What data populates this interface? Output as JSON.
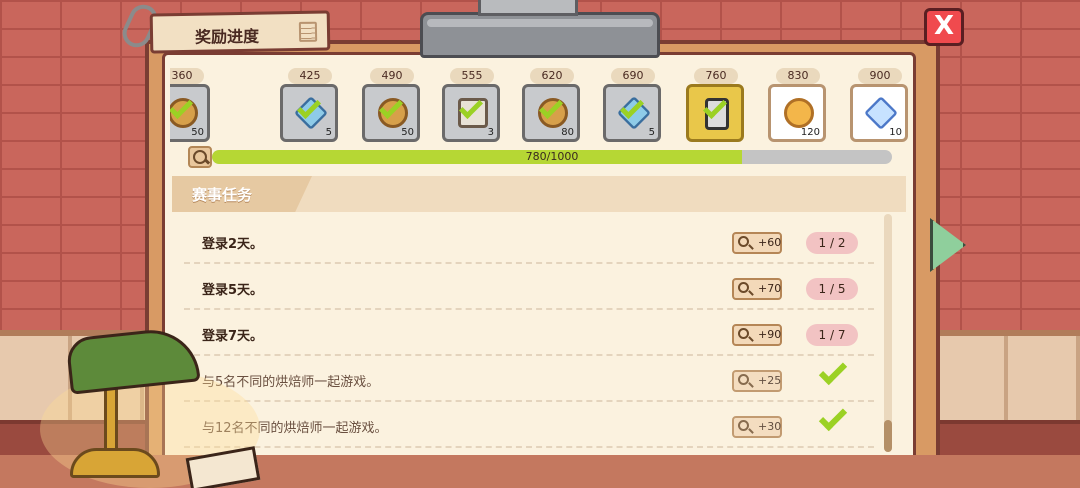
{
  "window": {
    "title": "奖励进度",
    "close_label": "X"
  },
  "rewards": [
    {
      "threshold": "360",
      "count": "50",
      "icon": "coin-icon",
      "state": "claimed"
    },
    {
      "threshold": "425",
      "count": "5",
      "icon": "gem-icon",
      "state": "claimed"
    },
    {
      "threshold": "490",
      "count": "50",
      "icon": "coin-icon",
      "state": "claimed"
    },
    {
      "threshold": "555",
      "count": "3",
      "icon": "ticket-icon",
      "state": "claimed"
    },
    {
      "threshold": "620",
      "count": "80",
      "icon": "coin-icon",
      "state": "claimed"
    },
    {
      "threshold": "690",
      "count": "5",
      "icon": "gem-icon",
      "state": "claimed"
    },
    {
      "threshold": "760",
      "count": "",
      "icon": "phone-icon",
      "state": "current"
    },
    {
      "threshold": "830",
      "count": "120",
      "icon": "coin-icon",
      "state": "locked"
    },
    {
      "threshold": "900",
      "count": "10",
      "icon": "gem-icon",
      "state": "locked"
    }
  ],
  "progress": {
    "text": "780/1000",
    "fraction": 0.78
  },
  "section": {
    "title": "赛事任务"
  },
  "tasks": [
    {
      "desc": "登录2天。",
      "points": "+60",
      "progress": "1 / 2",
      "done": false
    },
    {
      "desc": "登录5天。",
      "points": "+70",
      "progress": "1 / 5",
      "done": false
    },
    {
      "desc": "登录7天。",
      "points": "+90",
      "progress": "1 / 7",
      "done": false
    },
    {
      "desc": "与5名不同的烘焙师一起游戏。",
      "points": "+25",
      "progress": "",
      "done": true
    },
    {
      "desc": "与12名不同的烘焙师一起游戏。",
      "points": "+30",
      "progress": "",
      "done": true
    }
  ],
  "pagination": {
    "pages": 3,
    "active": 0
  },
  "colors": {
    "accent_green": "#b6d734",
    "progress_pink": "#f2c3c3",
    "close_red": "#f04a4e"
  }
}
